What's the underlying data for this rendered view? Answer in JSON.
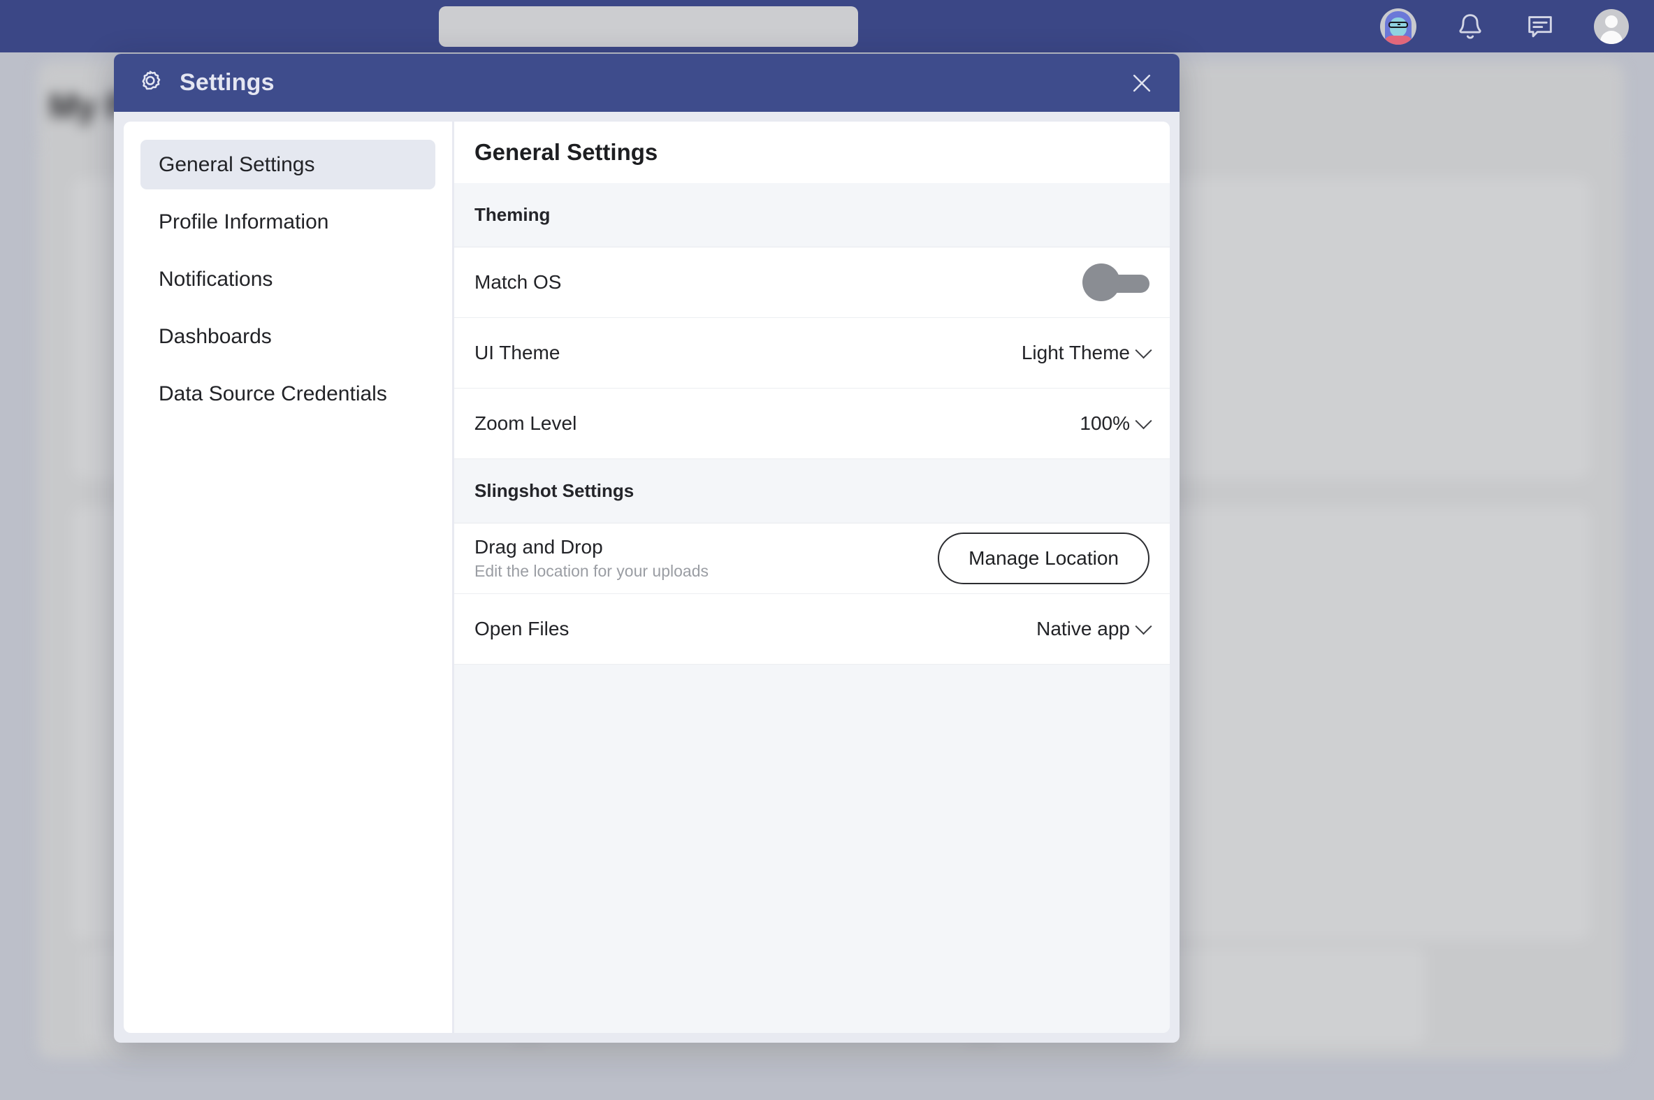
{
  "topnav": {
    "search_placeholder": "",
    "search_value": "",
    "icons": {
      "cartoon_avatar": "cartoon-avatar-icon",
      "bell": "bell-icon",
      "chat": "chat-icon",
      "profile": "profile-avatar-icon"
    },
    "background_color": "#3b4786"
  },
  "background_page": {
    "title": "My P"
  },
  "modal": {
    "title": "Settings",
    "gear_icon": "gear-icon",
    "close_icon": "close-icon",
    "header_color": "#3e4c8c"
  },
  "sidebar": {
    "items": [
      {
        "label": "General Settings",
        "active": true
      },
      {
        "label": "Profile Information",
        "active": false
      },
      {
        "label": "Notifications",
        "active": false
      },
      {
        "label": "Dashboards",
        "active": false
      },
      {
        "label": "Data Source Credentials",
        "active": false
      }
    ]
  },
  "content": {
    "title": "General Settings",
    "sections": [
      {
        "heading": "Theming",
        "rows": [
          {
            "label": "Match OS",
            "sublabel": "",
            "control": "toggle",
            "value": "off"
          },
          {
            "label": "UI Theme",
            "sublabel": "",
            "control": "dropdown",
            "value": "Light Theme"
          },
          {
            "label": "Zoom Level",
            "sublabel": "",
            "control": "dropdown",
            "value": "100%"
          }
        ]
      },
      {
        "heading": "Slingshot Settings",
        "rows": [
          {
            "label": "Drag and Drop",
            "sublabel": "Edit the location for your uploads",
            "control": "button",
            "value": "Manage Location"
          },
          {
            "label": "Open Files",
            "sublabel": "",
            "control": "dropdown",
            "value": "Native app"
          }
        ]
      }
    ]
  }
}
